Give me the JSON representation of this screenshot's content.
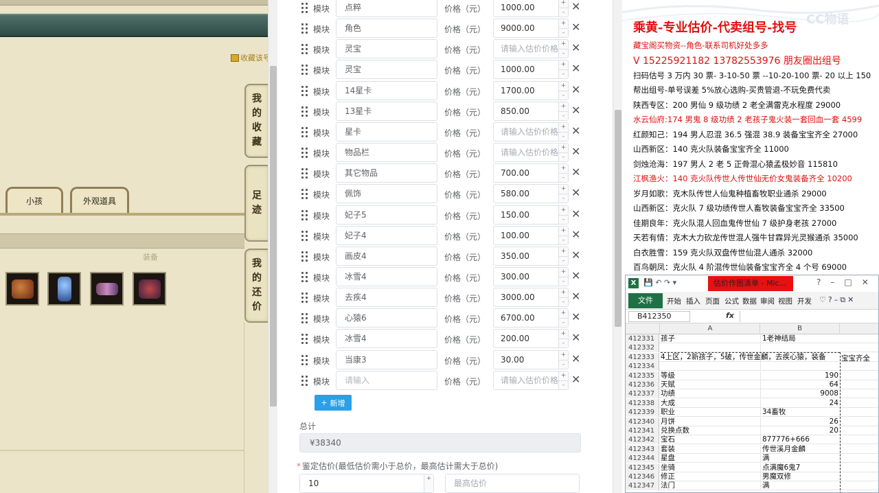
{
  "game": {
    "favorite_link": "收藏该号",
    "side_tabs": {
      "favorites": [
        "我",
        "的",
        "收",
        "藏"
      ],
      "footprint": [
        "足",
        "迹"
      ],
      "counter_offer": [
        "我",
        "的",
        "还",
        "价"
      ]
    },
    "tabs": [
      "小孩",
      "外观道具"
    ],
    "equip_label": "装备"
  },
  "form": {
    "module_label": "模块",
    "price_label": "价格（元）",
    "rows": [
      {
        "name": "点粹",
        "price": "1000.00"
      },
      {
        "name": "角色",
        "price": "9000.00"
      },
      {
        "name": "灵宝",
        "price": ""
      },
      {
        "name": "灵宝",
        "price": "1000.00"
      },
      {
        "name": "14星卡",
        "price": "1700.00"
      },
      {
        "name": "13星卡",
        "price": "850.00"
      },
      {
        "name": "星卡",
        "price": ""
      },
      {
        "name": "物品栏",
        "price": ""
      },
      {
        "name": "其它物品",
        "price": "700.00"
      },
      {
        "name": "佩饰",
        "price": "580.00"
      },
      {
        "name": "妃子5",
        "price": "150.00"
      },
      {
        "name": "妃子4",
        "price": "100.00"
      },
      {
        "name": "画皮4",
        "price": "350.00"
      },
      {
        "name": "冰雪4",
        "price": "300.00"
      },
      {
        "name": "去疾4",
        "price": "3000.00"
      },
      {
        "name": "心猿6",
        "price": "6700.00"
      },
      {
        "name": "冰雪4",
        "price": "200.00"
      },
      {
        "name": "当康3",
        "price": "30.00"
      },
      {
        "name": "",
        "price": ""
      }
    ],
    "name_placeholder": "请输入",
    "price_placeholder": "请输入估价价格",
    "add_button": "新增",
    "total_label": "总计",
    "total_value": "¥38340",
    "appraise_label": "鉴定估价(最低估价需小于总价，最高估计需大于总价)",
    "min_value": "10",
    "max_placeholder": "最高估价"
  },
  "ad": {
    "watermark": "CC物语",
    "title": "乘黄-专业估价-代卖组号-找号",
    "lines": [
      {
        "text": "藏宝阁买物资--角色-联系司机好处多多",
        "style": "red"
      },
      {
        "text": "V 15225921182   13782553976 朋友圈出组号",
        "style": "big"
      },
      {
        "text": "扫码估号 3 万内 30 票- 3-10-50 票  --10-20-100 票- 20 以上 150",
        "style": ""
      },
      {
        "text": "帮出组号-单号误差 5%放心选购-买贵管退-不玩免费代卖",
        "style": ""
      },
      {
        "text": "陕西专区：200 男仙 9 级功绩 2 老全满雷克水程度 29000",
        "style": ""
      },
      {
        "text": "水云仙府:174 男鬼 8 级功绩 2 老孩子鬼火装一套回血一套 4599",
        "style": "red"
      },
      {
        "text": "红颜知己：194 男人忍混 36.5 强混 38.9 装备宝宝齐全 27000",
        "style": ""
      },
      {
        "text": "山西新区：140 克火队装备宝宝齐全 11000",
        "style": ""
      },
      {
        "text": "剑烛沧海：197 男人 2 老 5 正骨混心猿孟极妙音 115810",
        "style": ""
      },
      {
        "text": "江枫渔火：140 克火队传世人传世仙无价女鬼装备齐全 10200",
        "style": "red"
      },
      {
        "text": "岁月如歌：克木队传世人仙鬼种植畜牧职业通杀 29000",
        "style": ""
      },
      {
        "text": "山西新区：克火队 7 级功绩传世人畜牧装备宝宝齐全 33500",
        "style": ""
      },
      {
        "text": "佳期良年：克火队混人回血鬼传世仙 7 级护身老孩 27000",
        "style": ""
      },
      {
        "text": "天若有情：克木大力砍龙传世混人强牛甘霖异光灵猴通杀 35000",
        "style": ""
      },
      {
        "text": "白衣胜雪：159 克火队双盘传世仙混人通杀 32000",
        "style": ""
      },
      {
        "text": "百鸟朝凤：克火队 4 阶混传世仙装备宝宝齐全 4 个号 69000",
        "style": ""
      }
    ]
  },
  "excel": {
    "logo": "X",
    "doc_title": "估价作图清单 - Mic...",
    "file_tab": "文件",
    "tabs": [
      "开始",
      "插入",
      "页面",
      "公式",
      "数据",
      "审阅",
      "视图",
      "开发"
    ],
    "name_box": "B412350",
    "fx": "fx",
    "col_a": "A",
    "col_b": "B",
    "cut_text": "宝宝齐全",
    "rows": [
      {
        "n": "412331",
        "a": "孩子",
        "b": "1老神结局",
        "num": false
      },
      {
        "n": "412332",
        "a": "",
        "b": "",
        "num": false
      },
      {
        "n": "412333",
        "a": "4上区，2新孩子，5破，传世金麟，去疾心猿，装备",
        "b": "",
        "num": false
      },
      {
        "n": "412334",
        "a": "",
        "b": "",
        "num": false
      },
      {
        "n": "412335",
        "a": "等级",
        "b": "190",
        "num": true
      },
      {
        "n": "412336",
        "a": "天赋",
        "b": "64",
        "num": true
      },
      {
        "n": "412337",
        "a": "功绩",
        "b": "9008",
        "num": true
      },
      {
        "n": "412338",
        "a": "大成",
        "b": "24",
        "num": true
      },
      {
        "n": "412339",
        "a": "职业",
        "b": "34畜牧",
        "num": false
      },
      {
        "n": "412340",
        "a": "月饼",
        "b": "26",
        "num": true
      },
      {
        "n": "412341",
        "a": "兑换点数",
        "b": "20",
        "num": true
      },
      {
        "n": "412342",
        "a": "宝石",
        "b": "877776+666",
        "num": false
      },
      {
        "n": "412343",
        "a": "套装",
        "b": "传世溪月金麟",
        "num": false
      },
      {
        "n": "412344",
        "a": "星盘",
        "b": "满",
        "num": false
      },
      {
        "n": "412345",
        "a": "坐骑",
        "b": "点满魔6鬼7",
        "num": false
      },
      {
        "n": "412346",
        "a": "修正",
        "b": "男魔双修",
        "num": false
      },
      {
        "n": "412347",
        "a": "法门",
        "b": "满",
        "num": false
      }
    ]
  }
}
